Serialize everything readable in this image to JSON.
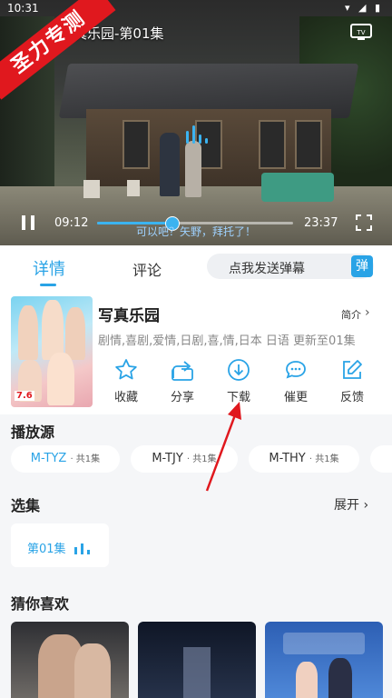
{
  "status_bar": {
    "time": "10:31",
    "icons": "▾ ◢ ▮"
  },
  "video": {
    "banner": "圣力专测",
    "title": "写真乐园-第01集",
    "current_time": "09:12",
    "total_time": "23:37",
    "progress": 0.38,
    "subtitle": "可以吧？矢野，拜托了！"
  },
  "tabs": {
    "detail": "详情",
    "comment": "评论",
    "danmu_placeholder": "点我发送弹幕",
    "danmu_button": "弹"
  },
  "info": {
    "title": "写真乐园",
    "intro_label": "简介",
    "meta": "剧情,喜剧,爱情,日剧,喜,情,日本 日语 更新至01集",
    "poster_tag": "7.6"
  },
  "actions": [
    {
      "label": "收藏",
      "icon": "star-icon"
    },
    {
      "label": "分享",
      "icon": "share-icon"
    },
    {
      "label": "下载",
      "icon": "download-icon"
    },
    {
      "label": "催更",
      "icon": "chat-icon"
    },
    {
      "label": "反馈",
      "icon": "edit-icon"
    }
  ],
  "sources": {
    "title": "播放源",
    "items": [
      {
        "name": "M-TYZ",
        "count": "· 共1集",
        "active": true
      },
      {
        "name": "M-TJY",
        "count": "· 共1集",
        "active": false
      },
      {
        "name": "M-THY",
        "count": "· 共1集",
        "active": false
      }
    ]
  },
  "episodes": {
    "title": "选集",
    "expand": "展开",
    "items": [
      {
        "label": "第01集"
      }
    ]
  },
  "recommend": {
    "title": "猜你喜欢"
  },
  "colors": {
    "accent": "#29a3e6",
    "banner": "#e0181e",
    "arrow": "#e0181e"
  }
}
